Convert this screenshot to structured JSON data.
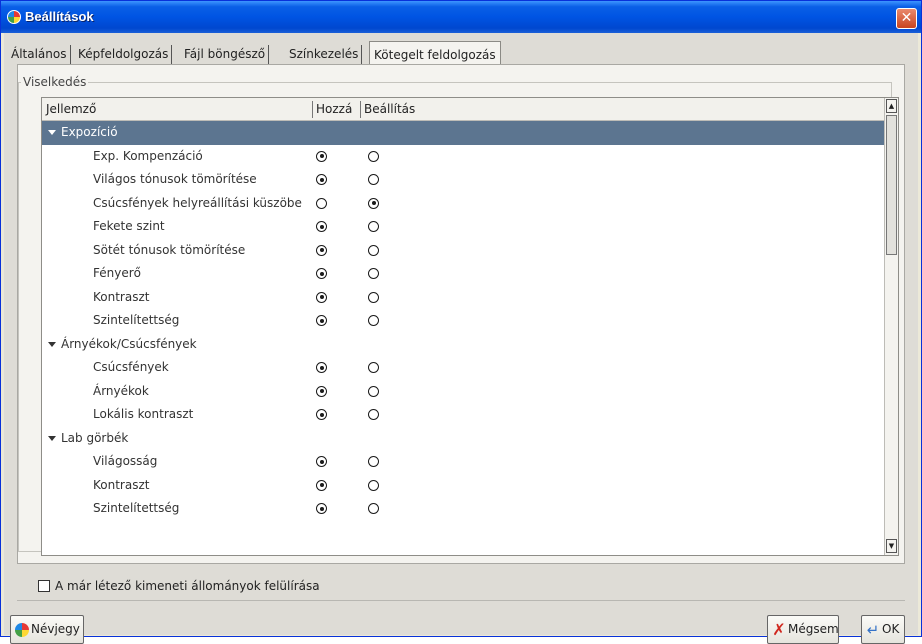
{
  "window": {
    "title": "Beállítások",
    "close_icon": "close-icon"
  },
  "tabs": [
    {
      "label": "Általános",
      "active": false
    },
    {
      "label": "Képfeldolgozás",
      "active": false
    },
    {
      "label": "Fájl böngésző",
      "active": false
    },
    {
      "label": "Színkezelés",
      "active": false
    },
    {
      "label": "Kötegelt feldolgozás",
      "active": true
    }
  ],
  "group": {
    "legend": "Viselkedés"
  },
  "tree": {
    "columns": [
      "Jellemző",
      "Hozzá",
      "Beállítás"
    ],
    "groups": [
      {
        "label": "Expozíció",
        "selected": true,
        "items": [
          {
            "label": "Exp. Kompenzáció",
            "value": "hozzaad"
          },
          {
            "label": "Világos tónusok tömörítése",
            "value": "hozzaad"
          },
          {
            "label": "Csúcsfények helyreállítási küszöbe",
            "value": "beallitas"
          },
          {
            "label": "Fekete szint",
            "value": "hozzaad"
          },
          {
            "label": "Sötét tónusok tömörítése",
            "value": "hozzaad"
          },
          {
            "label": "Fényerő",
            "value": "hozzaad"
          },
          {
            "label": "Kontraszt",
            "value": "hozzaad"
          },
          {
            "label": "Szintelítettség",
            "value": "hozzaad"
          }
        ]
      },
      {
        "label": "Árnyékok/Csúcsfények",
        "selected": false,
        "items": [
          {
            "label": "Csúcsfények",
            "value": "hozzaad"
          },
          {
            "label": "Árnyékok",
            "value": "hozzaad"
          },
          {
            "label": "Lokális kontraszt",
            "value": "hozzaad"
          }
        ]
      },
      {
        "label": "Lab görbék",
        "selected": false,
        "items": [
          {
            "label": "Világosság",
            "value": "hozzaad"
          },
          {
            "label": "Kontraszt",
            "value": "hozzaad"
          },
          {
            "label": "Szintelítettség",
            "value": "hozzaad"
          }
        ]
      }
    ]
  },
  "overwrite_checkbox": {
    "label": "A már létező kimeneti állományok felülírása",
    "checked": false
  },
  "buttons": {
    "about": "Névjegy",
    "cancel": "Mégsem",
    "ok": "OK"
  },
  "colors": {
    "titlebar": "#0054e3",
    "selected_row": "#5c7590"
  }
}
